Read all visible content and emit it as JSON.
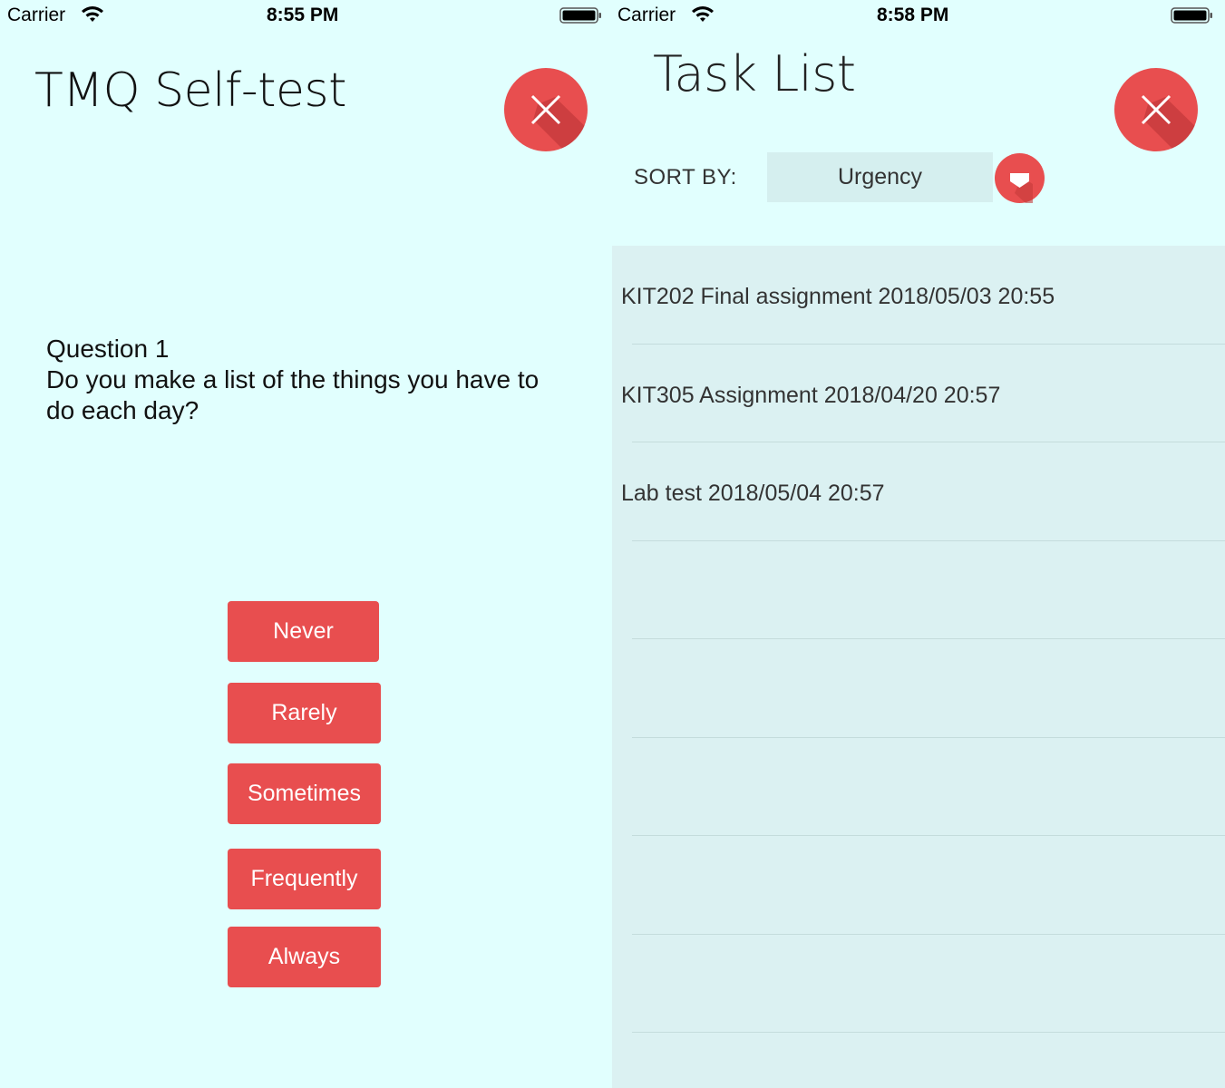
{
  "accent_color": "#e84e4f",
  "background_color": "#e1fffe",
  "left_screen": {
    "status_bar": {
      "carrier": "Carrier",
      "time": "8:55 PM"
    },
    "title": "TMQ Self-test",
    "question": {
      "number": "Question 1",
      "text": "Do you make a list of the things you have to\ndo each day?"
    },
    "answers": [
      {
        "label": "Never"
      },
      {
        "label": "Rarely"
      },
      {
        "label": "Sometimes"
      },
      {
        "label": "Frequently"
      },
      {
        "label": "Always"
      }
    ],
    "close_icon": "close-icon"
  },
  "right_screen": {
    "status_bar": {
      "carrier": "Carrier",
      "time": "8:58 PM"
    },
    "title": "Task List",
    "sort": {
      "label": "SORT BY:",
      "selected": "Urgency"
    },
    "tasks": [
      {
        "text": "KIT202 Final assignment 2018/05/03 20:55"
      },
      {
        "text": "KIT305 Assignment 2018/04/20 20:57"
      },
      {
        "text": "Lab test 2018/05/04 20:57"
      },
      {
        "text": ""
      },
      {
        "text": ""
      },
      {
        "text": ""
      },
      {
        "text": ""
      },
      {
        "text": ""
      }
    ],
    "close_icon": "close-icon",
    "dropdown_icon": "chevron-down-icon"
  }
}
